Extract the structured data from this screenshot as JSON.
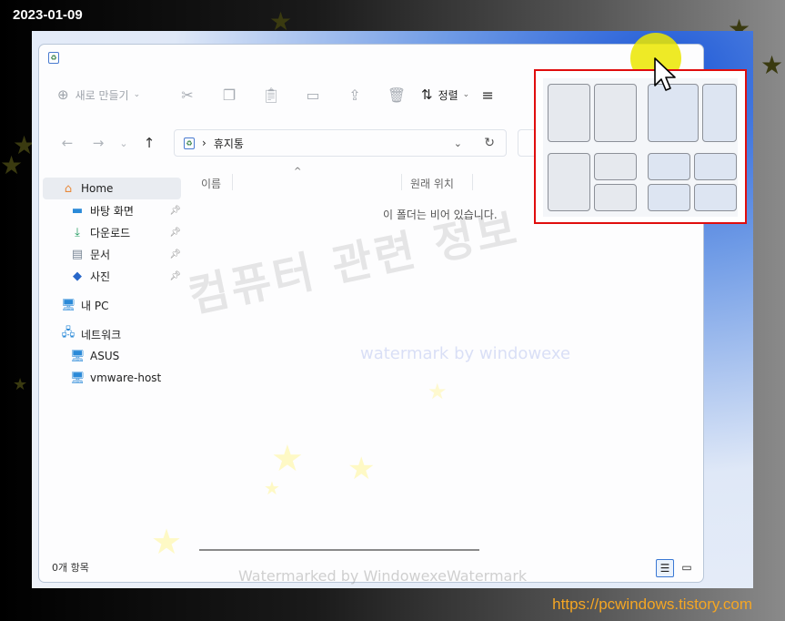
{
  "overlay": {
    "date": "2023-01-09",
    "site_url": "https://pcwindows.tistory.com"
  },
  "watermarks": {
    "main": "컴퓨터 관련 정보",
    "sub": "watermark by windowexe",
    "bottom": "Watermarked by WindowexeWatermark"
  },
  "toolbar": {
    "new_label": "새로 만들기",
    "sort_label": "정렬",
    "icons": [
      "cut-icon",
      "copy-icon",
      "paste-icon",
      "rename-icon",
      "share-icon",
      "delete-icon"
    ]
  },
  "address": {
    "location": "휴지통"
  },
  "sidebar": {
    "items": [
      {
        "label": "Home",
        "icon": "home-icon",
        "level": 1,
        "active": true,
        "pinned": false
      },
      {
        "label": "바탕 화면",
        "icon": "desktop-icon",
        "level": 2,
        "active": false,
        "pinned": true
      },
      {
        "label": "다운로드",
        "icon": "download-icon",
        "level": 2,
        "active": false,
        "pinned": true
      },
      {
        "label": "문서",
        "icon": "document-icon",
        "level": 2,
        "active": false,
        "pinned": true
      },
      {
        "label": "사진",
        "icon": "pictures-icon",
        "level": 2,
        "active": false,
        "pinned": true
      },
      {
        "label": "내 PC",
        "icon": "pc-icon",
        "level": 1,
        "active": false,
        "pinned": false
      },
      {
        "label": "네트워크",
        "icon": "network-icon",
        "level": 1,
        "active": false,
        "pinned": false
      },
      {
        "label": "ASUS",
        "icon": "computer-icon",
        "level": 2,
        "active": false,
        "pinned": false
      },
      {
        "label": "vmware-host",
        "icon": "computer-icon",
        "level": 2,
        "active": false,
        "pinned": false
      }
    ]
  },
  "columns": {
    "name": "이름",
    "original_location": "원래 위치"
  },
  "empty_message": "이 폴더는 비어 있습니다.",
  "status": {
    "item_count": "0개 항목"
  },
  "snap_layouts": {
    "highlight_color": "#e00d0d",
    "layouts": [
      "two-halves",
      "wide-narrow",
      "one-plus-two",
      "four-quadrants"
    ]
  },
  "colors": {
    "accent": "#3a78d4",
    "cursor_highlight": "#ebe600"
  }
}
